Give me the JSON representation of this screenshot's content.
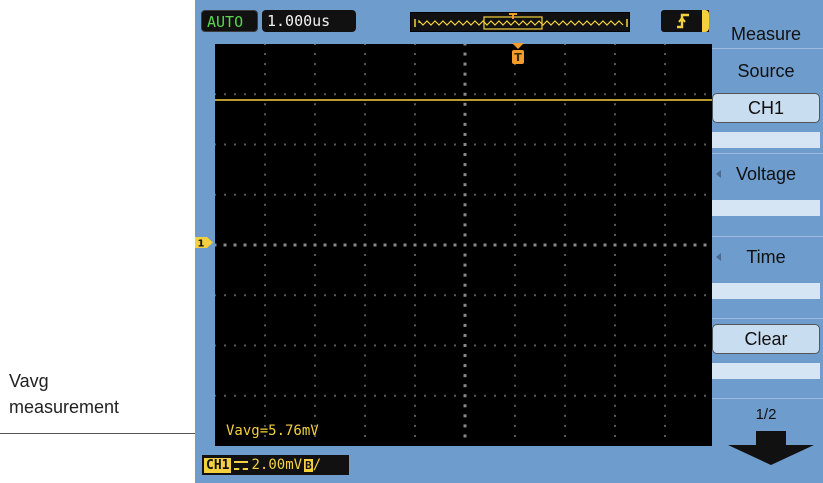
{
  "topbar": {
    "mode": "AUTO",
    "timebase": "1.000us",
    "trigger_slope_icon": "rising-edge-icon"
  },
  "channel": {
    "label": "CH1",
    "reference_marker": "1",
    "trigger_marker": "T",
    "volts_per_div": "2.00mV",
    "coupling_icon": "dc-coupling-icon",
    "bandwidth_limit": "B",
    "trailing_glyph": "/"
  },
  "readout": {
    "text": "Vavg=5.76mV"
  },
  "menu": {
    "title": "Measure",
    "source_label": "Source",
    "source_value": "CH1",
    "voltage_label": "Voltage",
    "time_label": "Time",
    "clear_label": "Clear",
    "page_label": "1/2",
    "page_arrow_icon": "down-arrow-icon"
  },
  "callout": {
    "line1": "Vavg",
    "line2": "measurement"
  },
  "colors": {
    "bezel": "#6d9ccd",
    "trace": "#f4d03f",
    "grid": "#3a3a3a",
    "auto_green": "#55d74a",
    "trigger_orange": "#f39c2a"
  }
}
